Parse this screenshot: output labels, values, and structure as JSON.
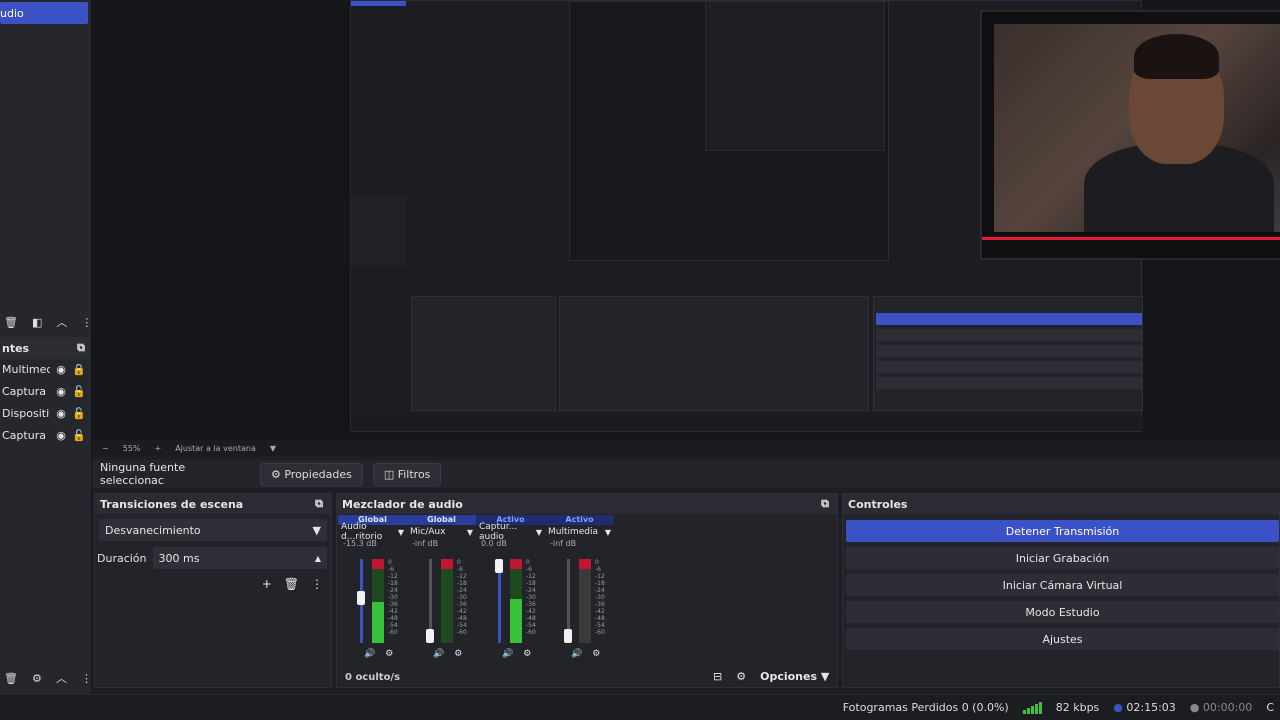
{
  "scenes": {
    "selected_label": "udio"
  },
  "sources_panel": {
    "title": "ntes",
    "items": [
      {
        "label": "Multimed",
        "locked": true
      },
      {
        "label": "Captura d",
        "locked": false
      },
      {
        "label": "Dispositiv",
        "locked": false
      },
      {
        "label": "Captura d",
        "locked": false
      }
    ]
  },
  "zoom": {
    "minus": "−",
    "level": "55%",
    "plus": "+",
    "fit_label": "Ajustar a la ventana"
  },
  "source_bar": {
    "no_source": "Ninguna fuente seleccionac",
    "properties": "Propiedades",
    "filters": "Filtros"
  },
  "transitions": {
    "title": "Transiciones de escena",
    "selected": "Desvanecimiento",
    "duration_label": "Duración",
    "duration_value": "300 ms"
  },
  "mixer": {
    "title": "Mezclador de audio",
    "hidden_count": "0 oculto/s",
    "options_label": "Opciones",
    "scale": [
      "0",
      "-6",
      "-12",
      "-18",
      "-24",
      "-30",
      "-36",
      "-42",
      "-48",
      "-54",
      "-60"
    ],
    "channels": [
      {
        "tag": "Global",
        "name": "Audio d...ritorio",
        "db": "-15.3 dB",
        "level": 0.55,
        "fader": 0.55
      },
      {
        "tag": "Global",
        "name": "Mic/Aux",
        "db": "-inf dB",
        "level": 0.0,
        "fader": 0.0
      },
      {
        "tag": "Activo",
        "name": "Captur... audio",
        "db": "0.0 dB",
        "level": 0.6,
        "fader": 1.0
      },
      {
        "tag": "Activo",
        "name": "Multimedia",
        "db": "-inf dB",
        "level": 0.0,
        "fader": 0.0,
        "muted": true
      }
    ]
  },
  "controls": {
    "title": "Controles",
    "buttons": [
      {
        "label": "Detener Transmisión",
        "active": true
      },
      {
        "label": "Iniciar Grabación",
        "active": false
      },
      {
        "label": "Iniciar Cámara Virtual",
        "active": false
      },
      {
        "label": "Modo Estudio",
        "active": false
      },
      {
        "label": "Ajustes",
        "active": false
      }
    ]
  },
  "status": {
    "dropped_frames": "Fotogramas Perdidos 0 (0.0%)",
    "bitrate": "82 kbps",
    "stream_time": "02:15:03",
    "record_time": "00:00:00",
    "trailing": "C"
  },
  "colors": {
    "accent": "#3a52c6",
    "meter_green": "#38c13a",
    "meter_red": "#c0162f",
    "webcam_accent": "#e8193a"
  }
}
